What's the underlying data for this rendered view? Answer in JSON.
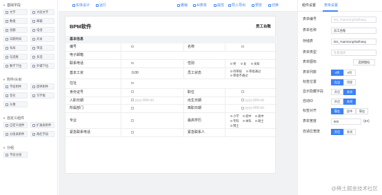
{
  "colors": {
    "accent": "#3b82f6"
  },
  "left": {
    "groups": [
      {
        "title": "基础字段",
        "icon": "triangle-down-icon",
        "items": [
          "文字",
          "大段文字",
          "数值",
          "邮箱",
          "金额",
          "电话",
          "日期时间",
          "开关",
          "布局",
          "单选",
          "勾选框",
          "多选",
          "数字下拉",
          "外键下拉"
        ]
      },
      {
        "title": "附件/头衔",
        "icon": "triangle-down-icon",
        "items": [
          "字段附件",
          "提供附件",
          "签名",
          "写字板",
          "头像"
        ]
      },
      {
        "title": "自定义组件",
        "icon": "triangle-down-icon",
        "items": [
          "自定义组件",
          "扩展表附件",
          "分组表附件",
          "两栏字段"
        ]
      },
      {
        "title": "分组",
        "icon": "triangle-down-icon",
        "items": [
          "字段分组"
        ]
      }
    ]
  },
  "toolbar": {
    "left": [
      {
        "label": "实体设计",
        "icon": "design-icon"
      },
      {
        "label": "运行",
        "icon": "play-icon"
      }
    ],
    "right": [
      {
        "label": "撤销",
        "icon": "undo-icon"
      },
      {
        "label": "AI表单",
        "icon": "ai-icon"
      },
      {
        "label": "属性",
        "icon": "property-icon"
      },
      {
        "label": "导入导出",
        "icon": "import-icon"
      },
      {
        "label": "预览",
        "icon": "preview-icon"
      },
      {
        "label": "切换",
        "icon": "switch-icon"
      }
    ]
  },
  "form": {
    "title": "BPM软件",
    "company": "员工台账",
    "section": "基本信息",
    "f": {
      "bianhao": "编号",
      "mingcheng": "名称",
      "email": "电子邮箱",
      "phone": "联系电话",
      "sex": "性别",
      "sex_male": "男",
      "sex_female": "女",
      "sex_unknown": "未知",
      "salary": "基本工资",
      "salary_val": "0.00",
      "status": "员工状态",
      "st1": "待审核",
      "st2": "审批通过",
      "st3": "审批不通过",
      "address": "住址",
      "idcard": "身份证号",
      "position": "职位",
      "join": "入职日期",
      "date_ph": "yyyy-MM-dd",
      "birth": "出生日期",
      "dept": "所属部门",
      "leave": "离职日期",
      "major": "专业",
      "edu": "最高学历",
      "e1": "小学",
      "e2": "初中",
      "e3": "高中",
      "e4": "专科",
      "e5": "本科",
      "e6": "硕士",
      "e7": "博士",
      "ecphone": "紧急联系电话",
      "ecperson": "紧急联系人"
    }
  },
  "right": {
    "tabs": [
      "组件设置",
      "表单设置"
    ],
    "props": {
      "formno_l": "表单编号",
      "formno_v": "Dct_YuanGongTaiZhang",
      "formname_l": "表单名称",
      "formname_v": "员工台账",
      "table_l": "存储表",
      "table_v": "Dct_YuanGongTaiZhang",
      "type_l": "表单类型",
      "type_ph": "任意选择",
      "icon_l": "表单图标",
      "icon_btn": "选择图标",
      "cols_l": "表单列数",
      "col4": "4列",
      "col6": "6列",
      "labelpos_l": "标签位置",
      "lp1": "左边",
      "lp2": "顶部",
      "showid_l": "显示隐藏字段",
      "on": "开启",
      "off": "关闭",
      "autoid_l": "自动ID",
      "align_l": "标签对齐",
      "al1": "靠左",
      "al2": "居中",
      "al3": "靠右",
      "width_l": "表单宽度",
      "width_v": "900",
      "width_unit": "(px)",
      "adapt_l": "自适应宽度"
    }
  },
  "watermark": "@稀土掘金技术社区"
}
